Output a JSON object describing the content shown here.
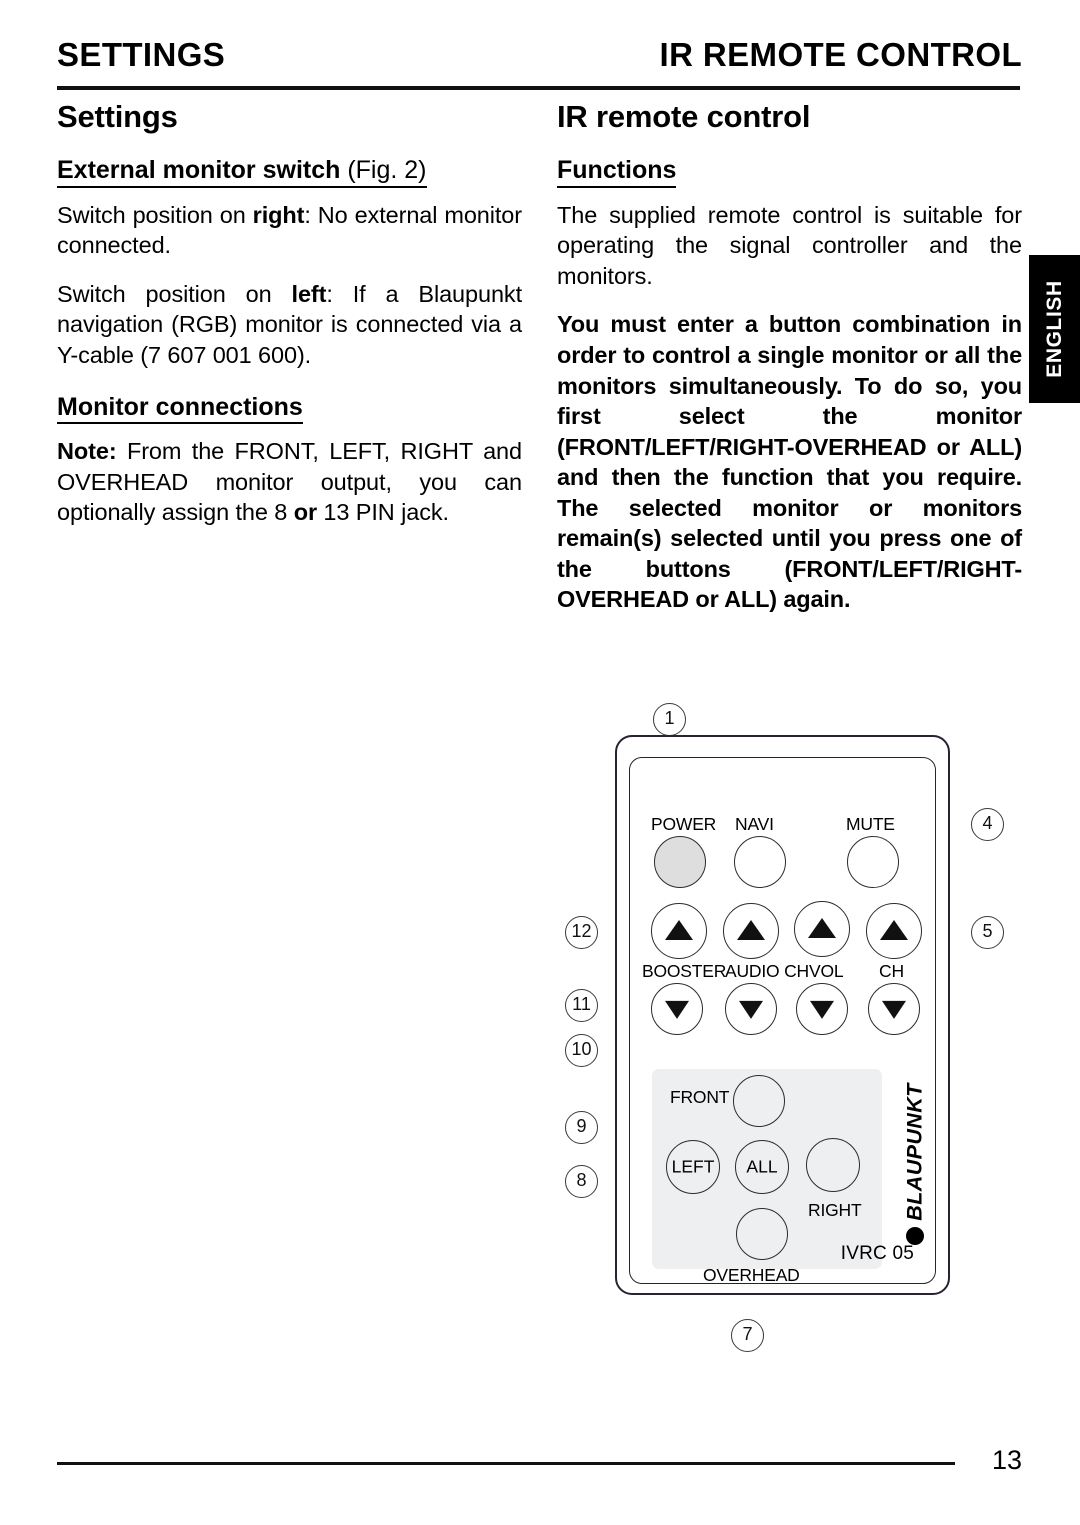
{
  "running_head": {
    "left": "SETTINGS",
    "right": "IR REMOTE CONTROL"
  },
  "language_tab": {
    "label": "ENGLISH"
  },
  "left_column": {
    "chapter_title": "Settings",
    "sections": [
      {
        "heading_bold": "External monitor switch",
        "heading_light": " (Fig. 2)",
        "paragraphs": [
          "Switch position on right: No external monitor connected.",
          "Switch position on left: If a Blaupunkt navigation (RGB) monitor is connected via a Y-cable (7 607 001 600)."
        ]
      },
      {
        "heading_bold": "Monitor connections",
        "heading_light": "",
        "paragraphs": [
          "Note: From the FRONT, LEFT, RIGHT and OVERHEAD monitor output, you can optionally assign the 8 or 13 PIN jack."
        ]
      }
    ]
  },
  "right_column": {
    "chapter_title": "IR remote control",
    "section_heading": "Functions",
    "paragraph": "The supplied remote control is suitable for operating the signal controller and the monitors.",
    "bold_paragraph": "You must enter a button combination in order to control a single monitor or all the monitors simultaneously. To do so, you first select the monitor (FRONT/LEFT/RIGHT-OVERHEAD or ALL) and then the function that you require. The selected monitor or monitors remain(s) selected until you press one of the buttons (FRONT/LEFT/RIGHT-OVERHEAD or ALL) again."
  },
  "remote": {
    "model_label": "IVRC 05",
    "brand": "BLAUPUNKT",
    "top_buttons": [
      {
        "label": "POWER",
        "filled": true
      },
      {
        "label": "NAVI",
        "filled": false
      },
      {
        "label": "MUTE",
        "filled": false
      }
    ],
    "rocker_labels": [
      "BOOSTER",
      "AUDIO CH",
      "VOL",
      "CH"
    ],
    "selection_buttons": [
      {
        "label": "FRONT",
        "position": "outside-left"
      },
      {
        "label": "LEFT",
        "position": "inside"
      },
      {
        "label": "ALL",
        "position": "inside"
      },
      {
        "label": "RIGHT",
        "position": "outside-below"
      },
      {
        "label": "OVERHEAD",
        "position": "outside-below"
      }
    ],
    "callouts": [
      "1",
      "4",
      "5",
      "12",
      "11",
      "10",
      "9",
      "8",
      "7"
    ]
  },
  "footer": {
    "page_number": "13"
  }
}
